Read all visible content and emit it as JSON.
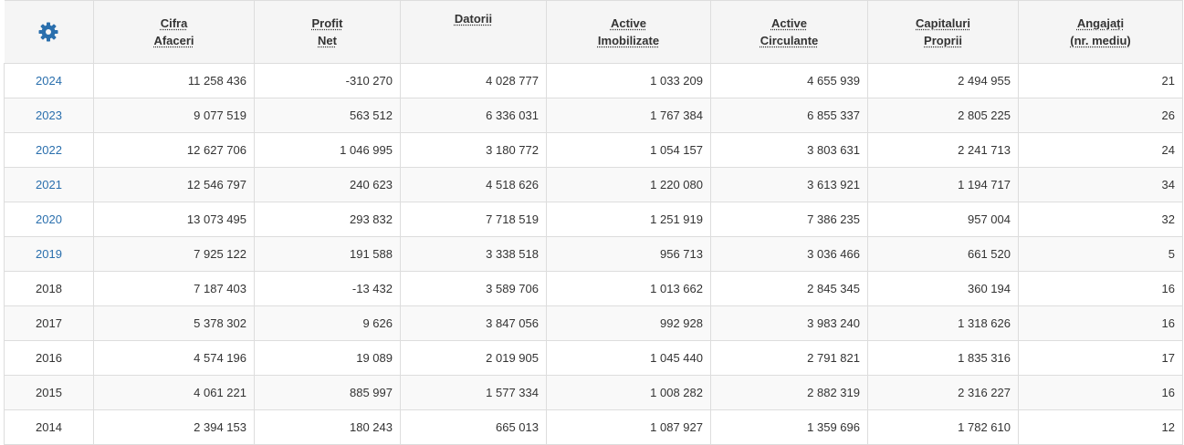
{
  "colors": {
    "accent": "#2a6fad",
    "header_bg": "#f5f5f5",
    "border": "#dddddd",
    "stripe": "#f9f9f9"
  },
  "header": {
    "settings_icon": "gear-icon",
    "columns": [
      {
        "line1": "Cifra",
        "line2": "Afaceri"
      },
      {
        "line1": "Profit",
        "line2": "Net"
      },
      {
        "line1": "Datorii",
        "line2": ""
      },
      {
        "line1": "Active",
        "line2": "Imobilizate"
      },
      {
        "line1": "Active",
        "line2": "Circulante"
      },
      {
        "line1": "Capitaluri",
        "line2": "Proprii"
      },
      {
        "line1": "Angajați",
        "line2": "(nr. mediu)"
      }
    ]
  },
  "rows": [
    {
      "year": "2024",
      "linked": true,
      "values": [
        "11 258 436",
        "-310 270",
        "4 028 777",
        "1 033 209",
        "4 655 939",
        "2 494 955",
        "21"
      ]
    },
    {
      "year": "2023",
      "linked": true,
      "values": [
        "9 077 519",
        "563 512",
        "6 336 031",
        "1 767 384",
        "6 855 337",
        "2 805 225",
        "26"
      ]
    },
    {
      "year": "2022",
      "linked": true,
      "values": [
        "12 627 706",
        "1 046 995",
        "3 180 772",
        "1 054 157",
        "3 803 631",
        "2 241 713",
        "24"
      ]
    },
    {
      "year": "2021",
      "linked": true,
      "values": [
        "12 546 797",
        "240 623",
        "4 518 626",
        "1 220 080",
        "3 613 921",
        "1 194 717",
        "34"
      ]
    },
    {
      "year": "2020",
      "linked": true,
      "values": [
        "13 073 495",
        "293 832",
        "7 718 519",
        "1 251 919",
        "7 386 235",
        "957 004",
        "32"
      ]
    },
    {
      "year": "2019",
      "linked": true,
      "values": [
        "7 925 122",
        "191 588",
        "3 338 518",
        "956 713",
        "3 036 466",
        "661 520",
        "5"
      ]
    },
    {
      "year": "2018",
      "linked": false,
      "values": [
        "7 187 403",
        "-13 432",
        "3 589 706",
        "1 013 662",
        "2 845 345",
        "360 194",
        "16"
      ]
    },
    {
      "year": "2017",
      "linked": false,
      "values": [
        "5 378 302",
        "9 626",
        "3 847 056",
        "992 928",
        "3 983 240",
        "1 318 626",
        "16"
      ]
    },
    {
      "year": "2016",
      "linked": false,
      "values": [
        "4 574 196",
        "19 089",
        "2 019 905",
        "1 045 440",
        "2 791 821",
        "1 835 316",
        "17"
      ]
    },
    {
      "year": "2015",
      "linked": false,
      "values": [
        "4 061 221",
        "885 997",
        "1 577 334",
        "1 008 282",
        "2 882 319",
        "2 316 227",
        "16"
      ]
    },
    {
      "year": "2014",
      "linked": false,
      "values": [
        "2 394 153",
        "180 243",
        "665 013",
        "1 087 927",
        "1 359 696",
        "1 782 610",
        "12"
      ]
    }
  ]
}
